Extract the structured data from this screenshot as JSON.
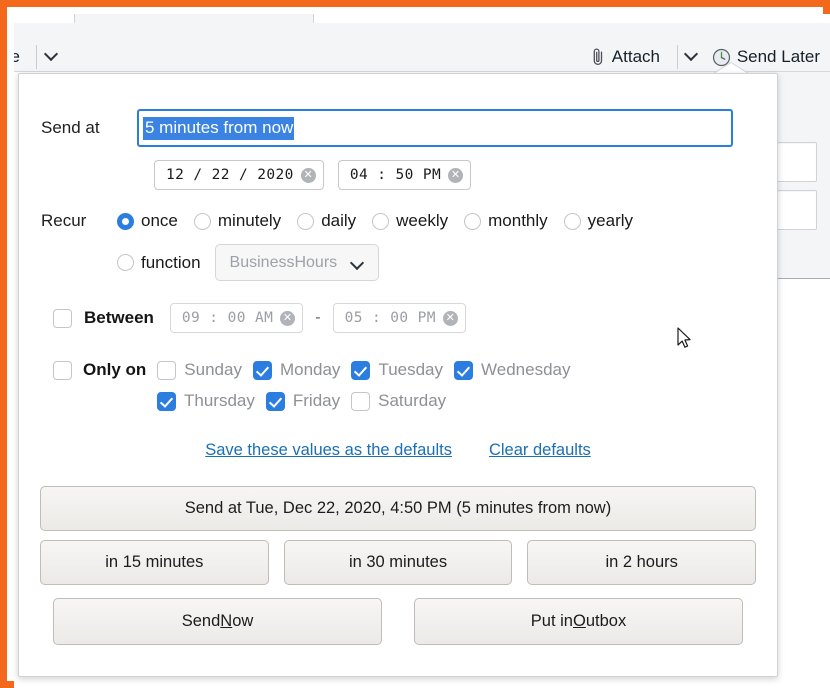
{
  "window": {
    "toolbar": {
      "save_label": "ve",
      "attach_label": "Attach",
      "send_later_label": "Send Later",
      "attach_icon": "paperclip-icon",
      "send_later_icon": "clock-icon",
      "chevron_icon": "chevron-down-icon"
    }
  },
  "popup": {
    "send_at": {
      "label": "Send at",
      "value": "5 minutes from now",
      "placeholder": "5 minutes from now",
      "date_value": "12 / 22 / 2020",
      "time_value": "04 : 50    PM",
      "clear_glyph": "✕"
    },
    "recur": {
      "label": "Recur",
      "options": [
        {
          "label": "once",
          "selected": true
        },
        {
          "label": "minutely",
          "selected": false
        },
        {
          "label": "daily",
          "selected": false
        },
        {
          "label": "weekly",
          "selected": false
        },
        {
          "label": "monthly",
          "selected": false
        },
        {
          "label": "yearly",
          "selected": false
        },
        {
          "label": "function",
          "selected": false
        }
      ],
      "function_select_value": "BusinessHours"
    },
    "between": {
      "label": "Between",
      "checked": false,
      "from_value": "09 : 00    AM",
      "to_value": "05 : 00    PM",
      "separator": "-"
    },
    "only_on": {
      "label": "Only on",
      "checked": false,
      "days": [
        {
          "label": "Sunday",
          "checked": false
        },
        {
          "label": "Monday",
          "checked": true
        },
        {
          "label": "Tuesday",
          "checked": true
        },
        {
          "label": "Wednesday",
          "checked": true
        },
        {
          "label": "Thursday",
          "checked": true
        },
        {
          "label": "Friday",
          "checked": true
        },
        {
          "label": "Saturday",
          "checked": false
        }
      ]
    },
    "links": {
      "save_defaults": "Save these values as the defaults",
      "clear_defaults": "Clear defaults"
    },
    "buttons": {
      "send_at_main": "Send at Tue, Dec 22, 2020, 4:50 PM (5 minutes from now)",
      "in_15_minutes": "in 15 minutes",
      "in_30_minutes": "in 30 minutes",
      "in_2_hours": "in 2 hours",
      "send_now_prefix": "Send ",
      "send_now_accel": "N",
      "send_now_suffix": "ow",
      "outbox_prefix": "Put in ",
      "outbox_accel": "O",
      "outbox_suffix": "utbox"
    }
  },
  "colors": {
    "frame": "#f3681a",
    "accent": "#2b7de0",
    "link": "#1a6fb5",
    "selection": "#3b83e3"
  }
}
